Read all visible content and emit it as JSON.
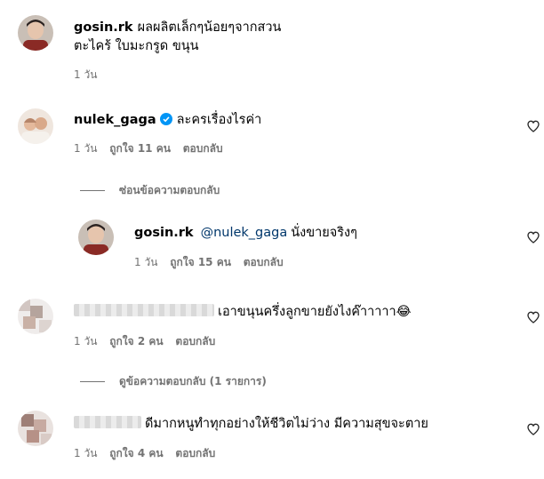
{
  "comments": [
    {
      "username": "gosin.rk",
      "text": "ผลผลิตเล็กๆน้อยๆจากสวน\nตะไคร้ ใบมะกรูด ขนุน",
      "time": "1 วัน"
    },
    {
      "username": "nulek_gaga",
      "text": "ละครเรื่องไรค่า",
      "time": "1 วัน",
      "likes": "ถูกใจ 11 คน",
      "reply_label": "ตอบกลับ",
      "heart_icon": "heart-outline-icon"
    },
    {
      "username": "gosin.rk",
      "mention": "@nulek_gaga",
      "text": "นั่งขายจริงๆ",
      "time": "1 วัน",
      "likes": "ถูกใจ 15 คน",
      "reply_label": "ตอบกลับ"
    },
    {
      "text": "เอาขนุนครึ่งลูกขายยังไงค๊าาาาา😂",
      "time": "1 วัน",
      "likes": "ถูกใจ 2 คน",
      "reply_label": "ตอบกลับ"
    },
    {
      "text": "ดีมากหนูทำทุกอย่างให้ชีวิตไม่ว่าง มีความสุขจะตาย",
      "time": "1 วัน",
      "likes": "ถูกใจ 4 คน",
      "reply_label": "ตอบกลับ"
    }
  ],
  "threads": {
    "hide_replies": "ซ่อนข้อความตอบกลับ",
    "view_replies": "ดูข้อความตอบกลับ (1 รายการ)"
  },
  "colors": {
    "muted": "#737373",
    "mention": "#00376b",
    "verified": "#0095f6"
  }
}
